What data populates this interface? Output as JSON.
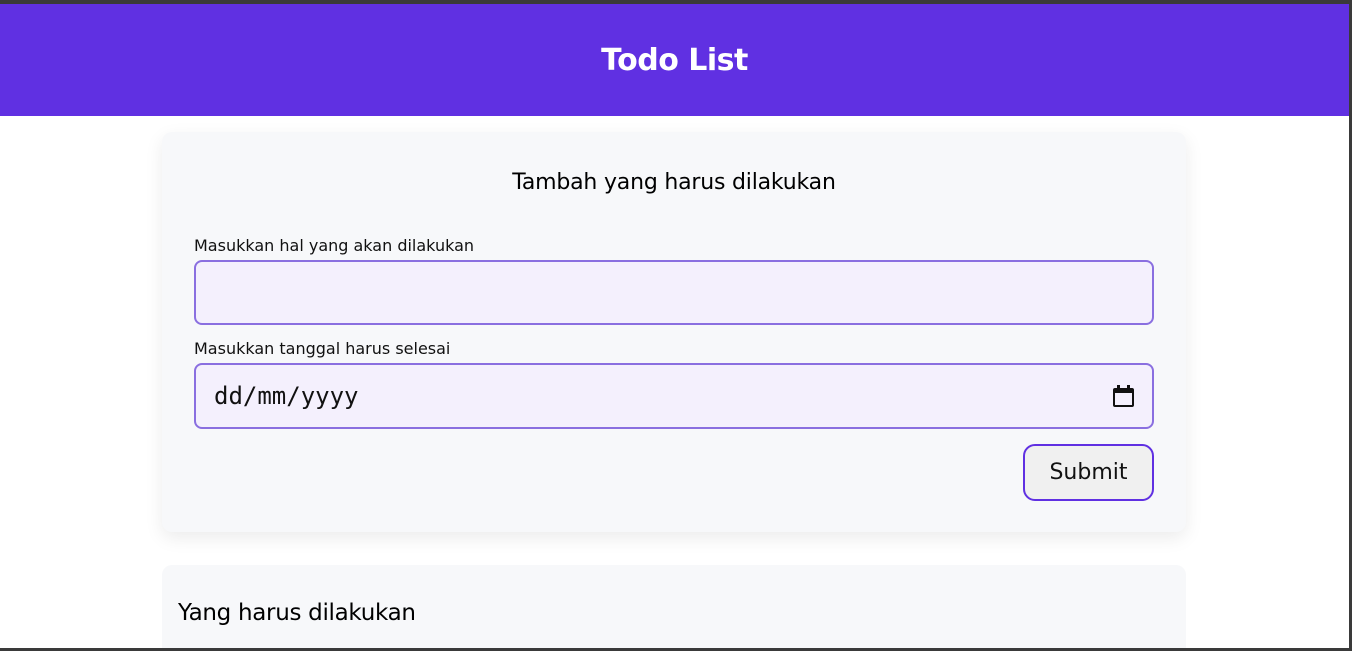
{
  "header": {
    "title": "Todo List"
  },
  "add_form": {
    "heading": "Tambah yang harus dilakukan",
    "title_label": "Masukkan hal yang akan dilakukan",
    "title_value": "",
    "date_label": "Masukkan tanggal harus selesai",
    "date_placeholder": "dd/mm/yyyy",
    "submit_label": "Submit"
  },
  "todo_list": {
    "heading": "Yang harus dilakukan"
  },
  "icons": {
    "calendar": "calendar-icon"
  },
  "colors": {
    "brand": "#6030e2",
    "input_background": "#f4f0fd",
    "input_border": "#8a6fe0",
    "card_background": "#f7f8fa"
  }
}
